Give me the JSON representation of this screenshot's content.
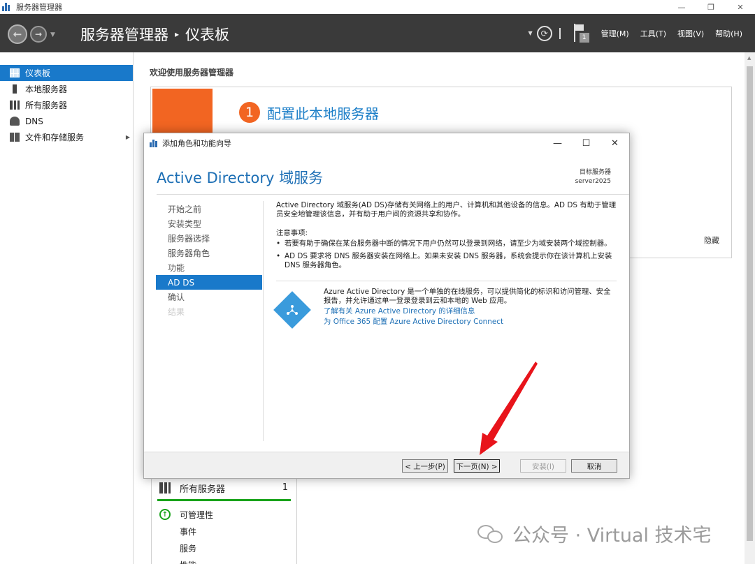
{
  "window": {
    "title": "服务器管理器",
    "controls": {
      "minimize": "—",
      "restore": "❐",
      "close": "✕"
    }
  },
  "header": {
    "breadcrumb_root": "服务器管理器",
    "breadcrumb_sep": "▸",
    "breadcrumb_page": "仪表板",
    "notification_count": "1",
    "menu": {
      "manage": "管理(M)",
      "tools": "工具(T)",
      "view": "视图(V)",
      "help": "帮助(H)"
    }
  },
  "sidebar": {
    "items": [
      {
        "label": "仪表板",
        "icon": "dashboard-icon",
        "active": true
      },
      {
        "label": "本地服务器",
        "icon": "server-icon"
      },
      {
        "label": "所有服务器",
        "icon": "servers-icon"
      },
      {
        "label": "DNS",
        "icon": "dns-icon"
      },
      {
        "label": "文件和存储服务",
        "icon": "file-storage-icon",
        "expandable": true
      }
    ]
  },
  "main": {
    "welcome_title": "欢迎使用服务器管理器",
    "step_number": "1",
    "step_label": "配置此本地服务器",
    "hide_label": "隐藏",
    "tile": {
      "title": "所有服务器",
      "count": "1",
      "rows": [
        "可管理性",
        "事件",
        "服务",
        "性能"
      ]
    }
  },
  "dialog": {
    "title": "添加角色和功能向导",
    "heading": "Active Directory 域服务",
    "target_label": "目标服务器",
    "target_server": "server2025",
    "steps": [
      {
        "label": "开始之前",
        "state": "normal"
      },
      {
        "label": "安装类型",
        "state": "normal"
      },
      {
        "label": "服务器选择",
        "state": "normal"
      },
      {
        "label": "服务器角色",
        "state": "normal"
      },
      {
        "label": "功能",
        "state": "normal"
      },
      {
        "label": "AD DS",
        "state": "current"
      },
      {
        "label": "确认",
        "state": "normal"
      },
      {
        "label": "结果",
        "state": "disabled"
      }
    ],
    "intro": "Active Directory 域服务(AD DS)存储有关网络上的用户、计算机和其他设备的信息。AD DS 有助于管理员安全地管理该信息，并有助于用户间的资源共享和协作。",
    "notes_title": "注意事项:",
    "notes": [
      "若要有助于确保在某台服务器中断的情况下用户仍然可以登录到网络，请至少为域安装两个域控制器。",
      "AD DS 要求将 DNS 服务器安装在网络上。如果未安装 DNS 服务器，系统会提示你在该计算机上安装 DNS 服务器角色。"
    ],
    "azure_text": "Azure Active Directory 是一个单独的在线服务，可以提供简化的标识和访问管理、安全报告，并允许通过单一登录登录到云和本地的 Web 应用。",
    "azure_link1": "了解有关 Azure Active Directory 的详细信息",
    "azure_link2": "为 Office 365 配置 Azure Active Directory Connect",
    "buttons": {
      "prev": "< 上一步(P)",
      "next": "下一页(N) >",
      "install": "安装(I)",
      "cancel": "取消"
    }
  },
  "watermark": "公众号 · Virtual 技术宅",
  "colors": {
    "header_bg": "#3a3a3a",
    "accent_blue": "#1979ca",
    "orange": "#f26522",
    "ok_green": "#18a31a",
    "annotation_red": "#e8141b"
  }
}
